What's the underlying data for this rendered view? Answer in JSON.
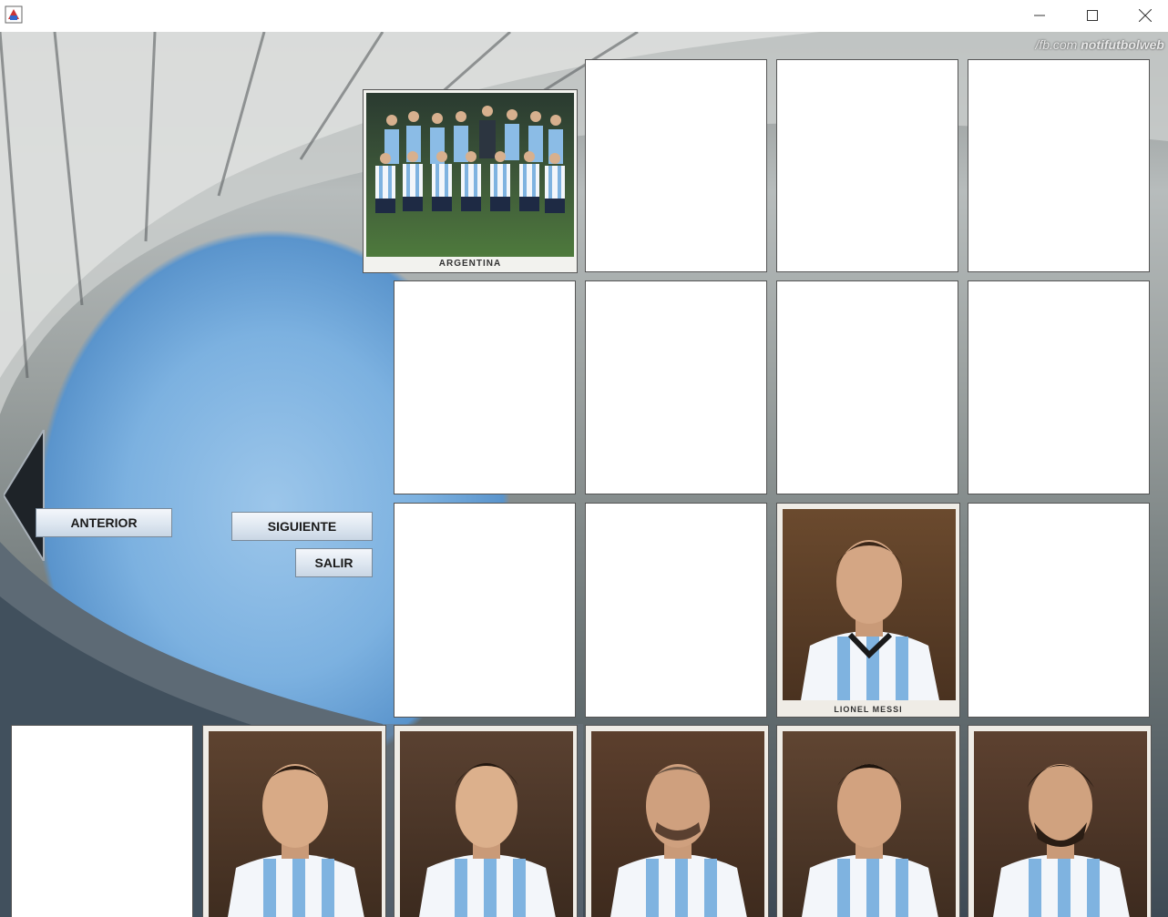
{
  "window": {
    "title": "",
    "controls": [
      "minimize",
      "maximize",
      "close"
    ]
  },
  "watermark": {
    "site": "/fb.com",
    "brand": "notifutbolweb"
  },
  "buttons": {
    "anterior": "ANTERIOR",
    "siguiente": "SIGUIENTE",
    "salir": "SALIR"
  },
  "stickers": {
    "team": "ARGENTINA",
    "messi": "LIONEL MESSI"
  },
  "colors": {
    "shirt_blue": "#7fb3e0",
    "sticker_bg": "#6b4a2e"
  }
}
